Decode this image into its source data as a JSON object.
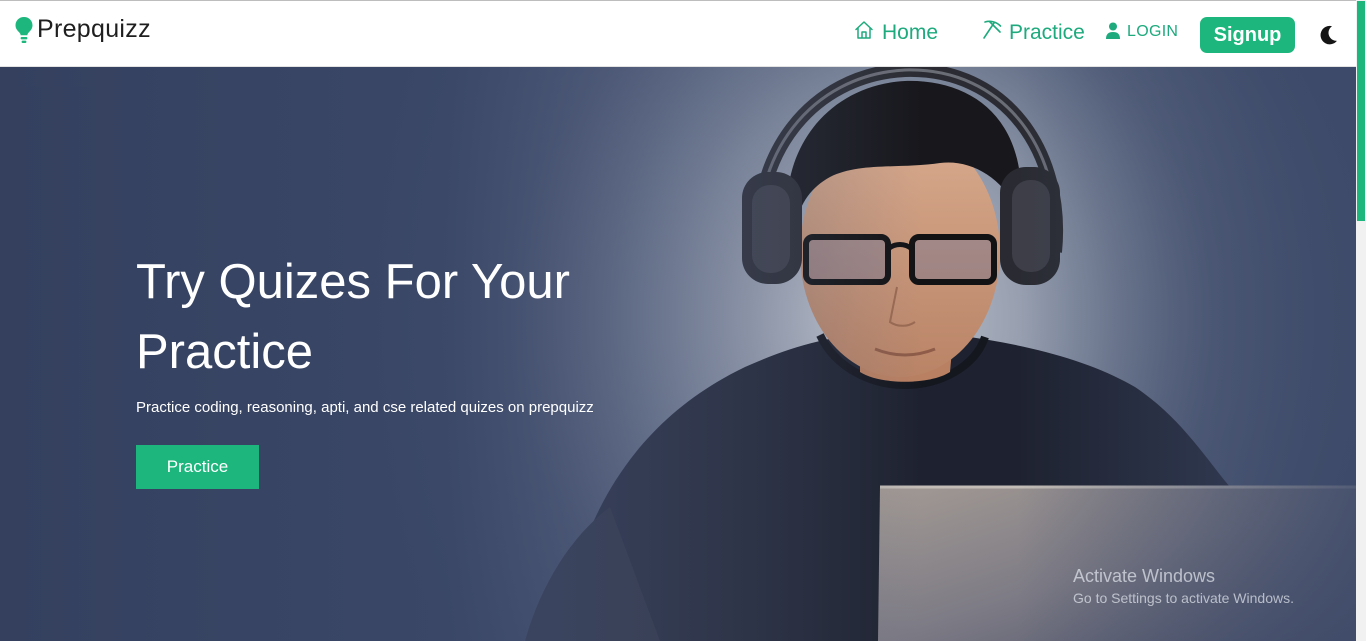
{
  "brand": {
    "name": "Prepquizz",
    "icon": "lightbulb-icon"
  },
  "nav": {
    "home": {
      "label": "Home",
      "icon": "home-icon"
    },
    "practice": {
      "label": "Practice",
      "icon": "pickaxe-icon"
    },
    "login": {
      "label": "LOGIN",
      "icon": "user-icon"
    },
    "signup": {
      "label": "Signup"
    },
    "theme_toggle": {
      "icon": "moon-icon"
    }
  },
  "hero": {
    "title": "Try Quizes For Your Practice",
    "subtitle": "Practice coding, reasoning, apti, and cse related quizes on prepquizz",
    "cta_label": "Practice"
  },
  "watermark": {
    "title": "Activate Windows",
    "subtitle": "Go to Settings to activate Windows."
  },
  "colors": {
    "accent": "#1db77e",
    "nav_link": "#1eaa7d",
    "hero_overlay": "#3a4767"
  }
}
